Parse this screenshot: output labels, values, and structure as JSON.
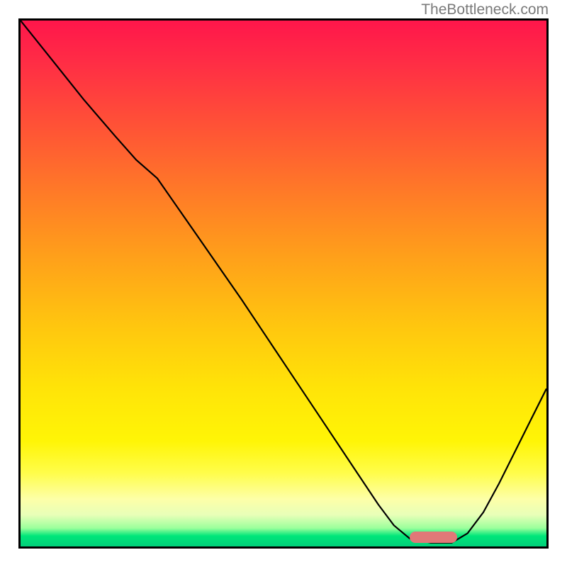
{
  "watermark": "TheBottleneck.com",
  "chart_data": {
    "type": "line",
    "title": "",
    "xlabel": "",
    "ylabel": "",
    "xlim": [
      0,
      100
    ],
    "ylim": [
      0,
      100
    ],
    "curve_points_pct": [
      [
        0.0,
        0.0
      ],
      [
        6.0,
        7.5
      ],
      [
        12.0,
        15.0
      ],
      [
        18.0,
        22.0
      ],
      [
        22.0,
        26.5
      ],
      [
        26.0,
        30.0
      ],
      [
        34.0,
        41.5
      ],
      [
        42.0,
        53.0
      ],
      [
        50.0,
        65.0
      ],
      [
        58.0,
        77.0
      ],
      [
        64.0,
        86.0
      ],
      [
        68.0,
        92.0
      ],
      [
        71.0,
        96.0
      ],
      [
        74.0,
        98.5
      ],
      [
        78.0,
        99.3
      ],
      [
        82.0,
        99.3
      ],
      [
        85.0,
        97.5
      ],
      [
        88.0,
        93.5
      ],
      [
        91.0,
        88.0
      ],
      [
        94.0,
        82.0
      ],
      [
        97.0,
        76.0
      ],
      [
        100.0,
        70.0
      ]
    ],
    "marker": {
      "x_start_pct": 74.0,
      "x_end_pct": 83.0,
      "y_pct": 98.2
    },
    "gradient_colors": {
      "top": "#ff164b",
      "mid": "#ffe408",
      "bottom": "#00d07a"
    }
  }
}
